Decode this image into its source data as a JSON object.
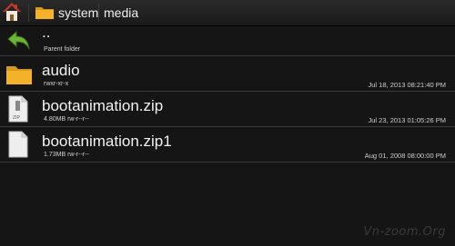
{
  "breadcrumb": {
    "items": [
      "system",
      "media"
    ]
  },
  "files": [
    {
      "name": "..",
      "subtitle": "Parent folder",
      "date": "",
      "icon": "back-arrow-icon"
    },
    {
      "name": "audio",
      "subtitle": "rwxr-xr-x",
      "date": "Jul 18, 2013 08:21:40 PM",
      "icon": "folder-icon"
    },
    {
      "name": "bootanimation.zip",
      "subtitle": "4.80MB rw-r--r--",
      "date": "Jul 23, 2013 01:05:26 PM",
      "icon": "zip-file-icon"
    },
    {
      "name": "bootanimation.zip1",
      "subtitle": "1.73MB rw-r--r--",
      "date": "Aug 01, 2008 08:00:00 PM",
      "icon": "file-icon"
    }
  ],
  "watermark": "Vn-zoom.Org",
  "colors": {
    "background": "#151515",
    "divider": "#3b3b3b",
    "folder": "#f3b22a",
    "back_arrow": "#6fb43a"
  }
}
